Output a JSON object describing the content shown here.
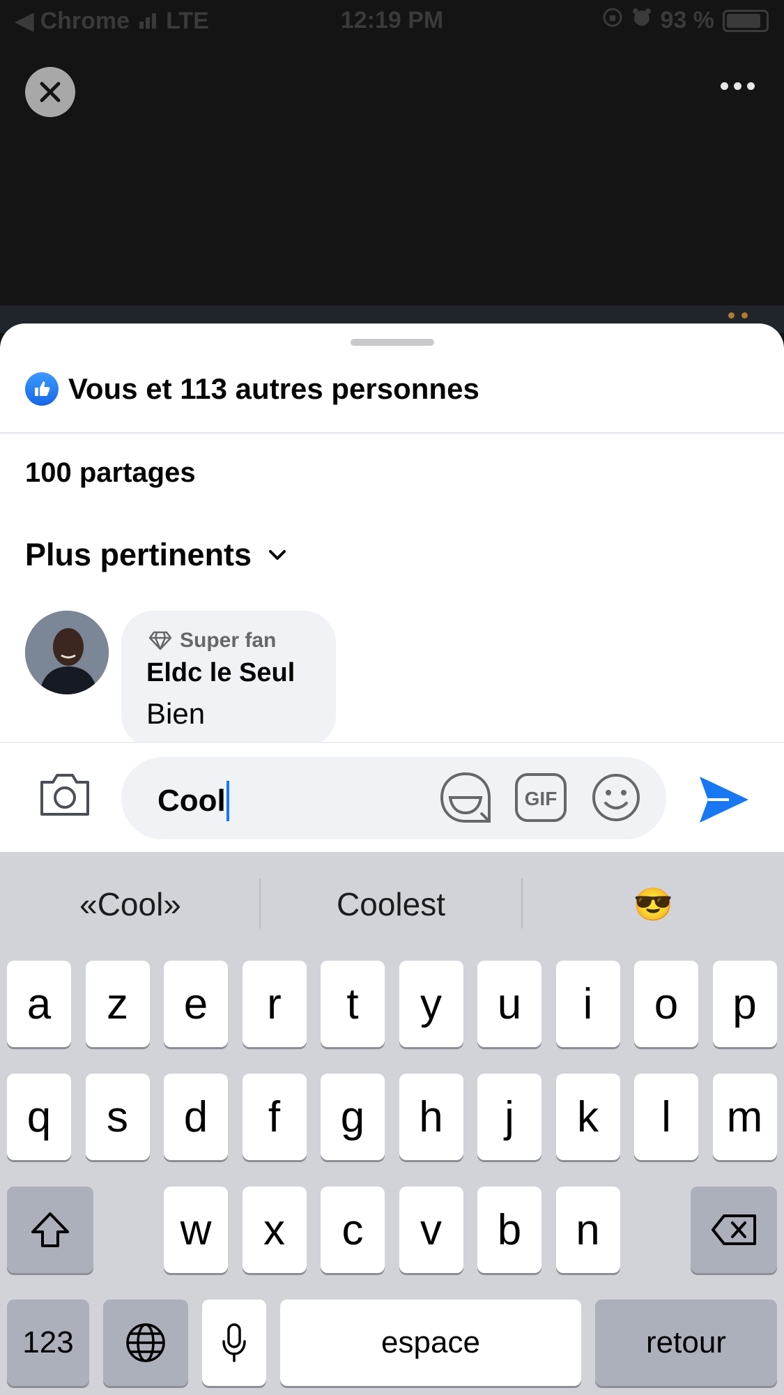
{
  "status_bar": {
    "carrier_back": "◀ Chrome",
    "network": "LTE",
    "time": "12:19 PM",
    "battery": "93 %"
  },
  "colors": {
    "accent_blue": "#1877f2",
    "like_blue": "#2d86ff",
    "bubble_gray": "#f0f2f5",
    "keyboard_bg": "#d1d3d9"
  },
  "top_controls": {
    "close_icon": "close-icon",
    "more_icon": "more-dots-icon"
  },
  "sheet": {
    "reactions_text": "Vous et 113 autres personnes",
    "shares_text": "100 partages",
    "sort_label": "Plus pertinents",
    "comment": {
      "badge": "Super fan",
      "author": "Eldc le Seul",
      "text": "Bien"
    }
  },
  "composer": {
    "value": "Cool",
    "icons": [
      "camera-icon",
      "sticker-icon",
      "gif-icon",
      "emoji-icon",
      "send-icon"
    ]
  },
  "keyboard": {
    "suggestions": [
      "«Cool»",
      "Coolest",
      "😎"
    ],
    "row1": [
      "a",
      "z",
      "e",
      "r",
      "t",
      "y",
      "u",
      "i",
      "o",
      "p"
    ],
    "row2": [
      "q",
      "s",
      "d",
      "f",
      "g",
      "h",
      "j",
      "k",
      "l",
      "m"
    ],
    "row3": [
      "w",
      "x",
      "c",
      "v",
      "b",
      "n"
    ],
    "numbers_label": "123",
    "space_label": "espace",
    "return_label": "retour"
  }
}
